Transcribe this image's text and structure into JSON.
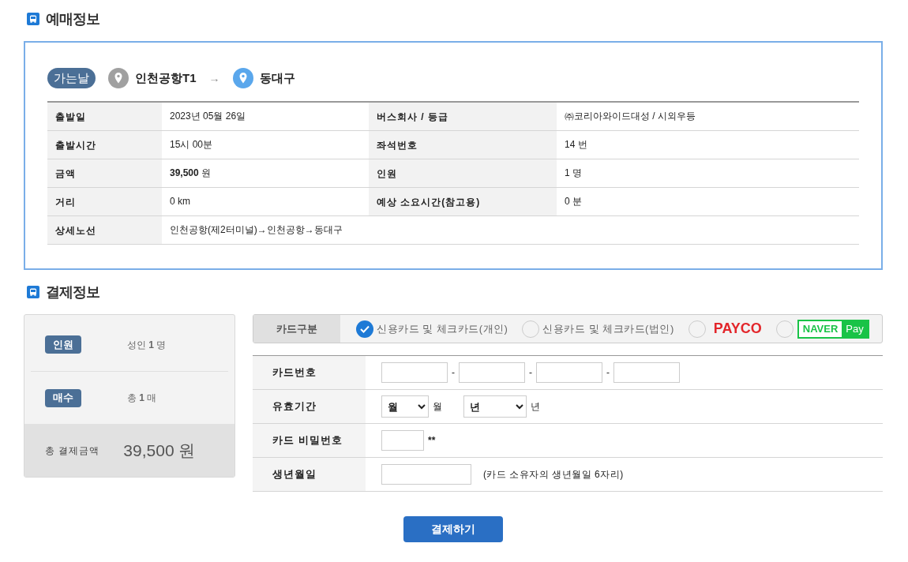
{
  "booking": {
    "title": "예매정보",
    "route": {
      "badge": "가는날",
      "origin": "인천공항T1",
      "arrow": "→",
      "destination": "동대구"
    },
    "rows": [
      {
        "cells": [
          {
            "label": "출발일",
            "value": "2023년 05월 26일"
          },
          {
            "label": "버스회사 / 등급",
            "value": "㈜코리아와이드대성 / 시외우등"
          }
        ]
      },
      {
        "cells": [
          {
            "label": "출발시간",
            "value": "15시 00분"
          },
          {
            "label": "좌석번호",
            "value": "14 번"
          }
        ]
      },
      {
        "cells": [
          {
            "label": "금액",
            "value": "**39,500** 원"
          },
          {
            "label": "인원",
            "value": "1 명"
          }
        ]
      },
      {
        "cells": [
          {
            "label": "거리",
            "value": "0 km"
          },
          {
            "label": "예상 소요시간(참고용)",
            "value": "0 분"
          }
        ]
      },
      {
        "cells": [
          {
            "label": "상세노선",
            "value": "인천공항(제2터미널)→인천공항→동대구"
          }
        ]
      }
    ]
  },
  "payment": {
    "title": "결제정보",
    "summary": {
      "items": [
        {
          "badge": "인원",
          "value": "성인 **1** 명"
        },
        {
          "badge": "매수",
          "value": "총 **1** 매"
        }
      ],
      "total": {
        "label": "총 결제금액",
        "amount": "39,500 원"
      }
    },
    "card_type": {
      "label": "카드구분",
      "options": [
        {
          "kind": "text",
          "label": "신용카드 및 체크카드(개인)",
          "selected": true
        },
        {
          "kind": "text",
          "label": "신용카드 및 체크카드(법인)",
          "selected": false
        },
        {
          "kind": "payco",
          "label": "PAYCO",
          "selected": false
        },
        {
          "kind": "naverpay",
          "label": "NAVER",
          "label2": "Pay",
          "selected": false
        }
      ]
    },
    "form": [
      {
        "kind": "card_number",
        "label": "카드번호",
        "separators": [
          "-",
          "-",
          "-"
        ]
      },
      {
        "kind": "expiry",
        "label": "유효기간",
        "selects": [
          {
            "value": "월",
            "suffix": "월"
          },
          {
            "value": "년",
            "suffix": "년"
          }
        ]
      },
      {
        "kind": "password",
        "label": "카드 비밀번호",
        "suffix": "**"
      },
      {
        "kind": "birth",
        "label": "생년월일",
        "note": "(카드 소유자의 생년월일 6자리)"
      }
    ],
    "submit": "결제하기"
  }
}
